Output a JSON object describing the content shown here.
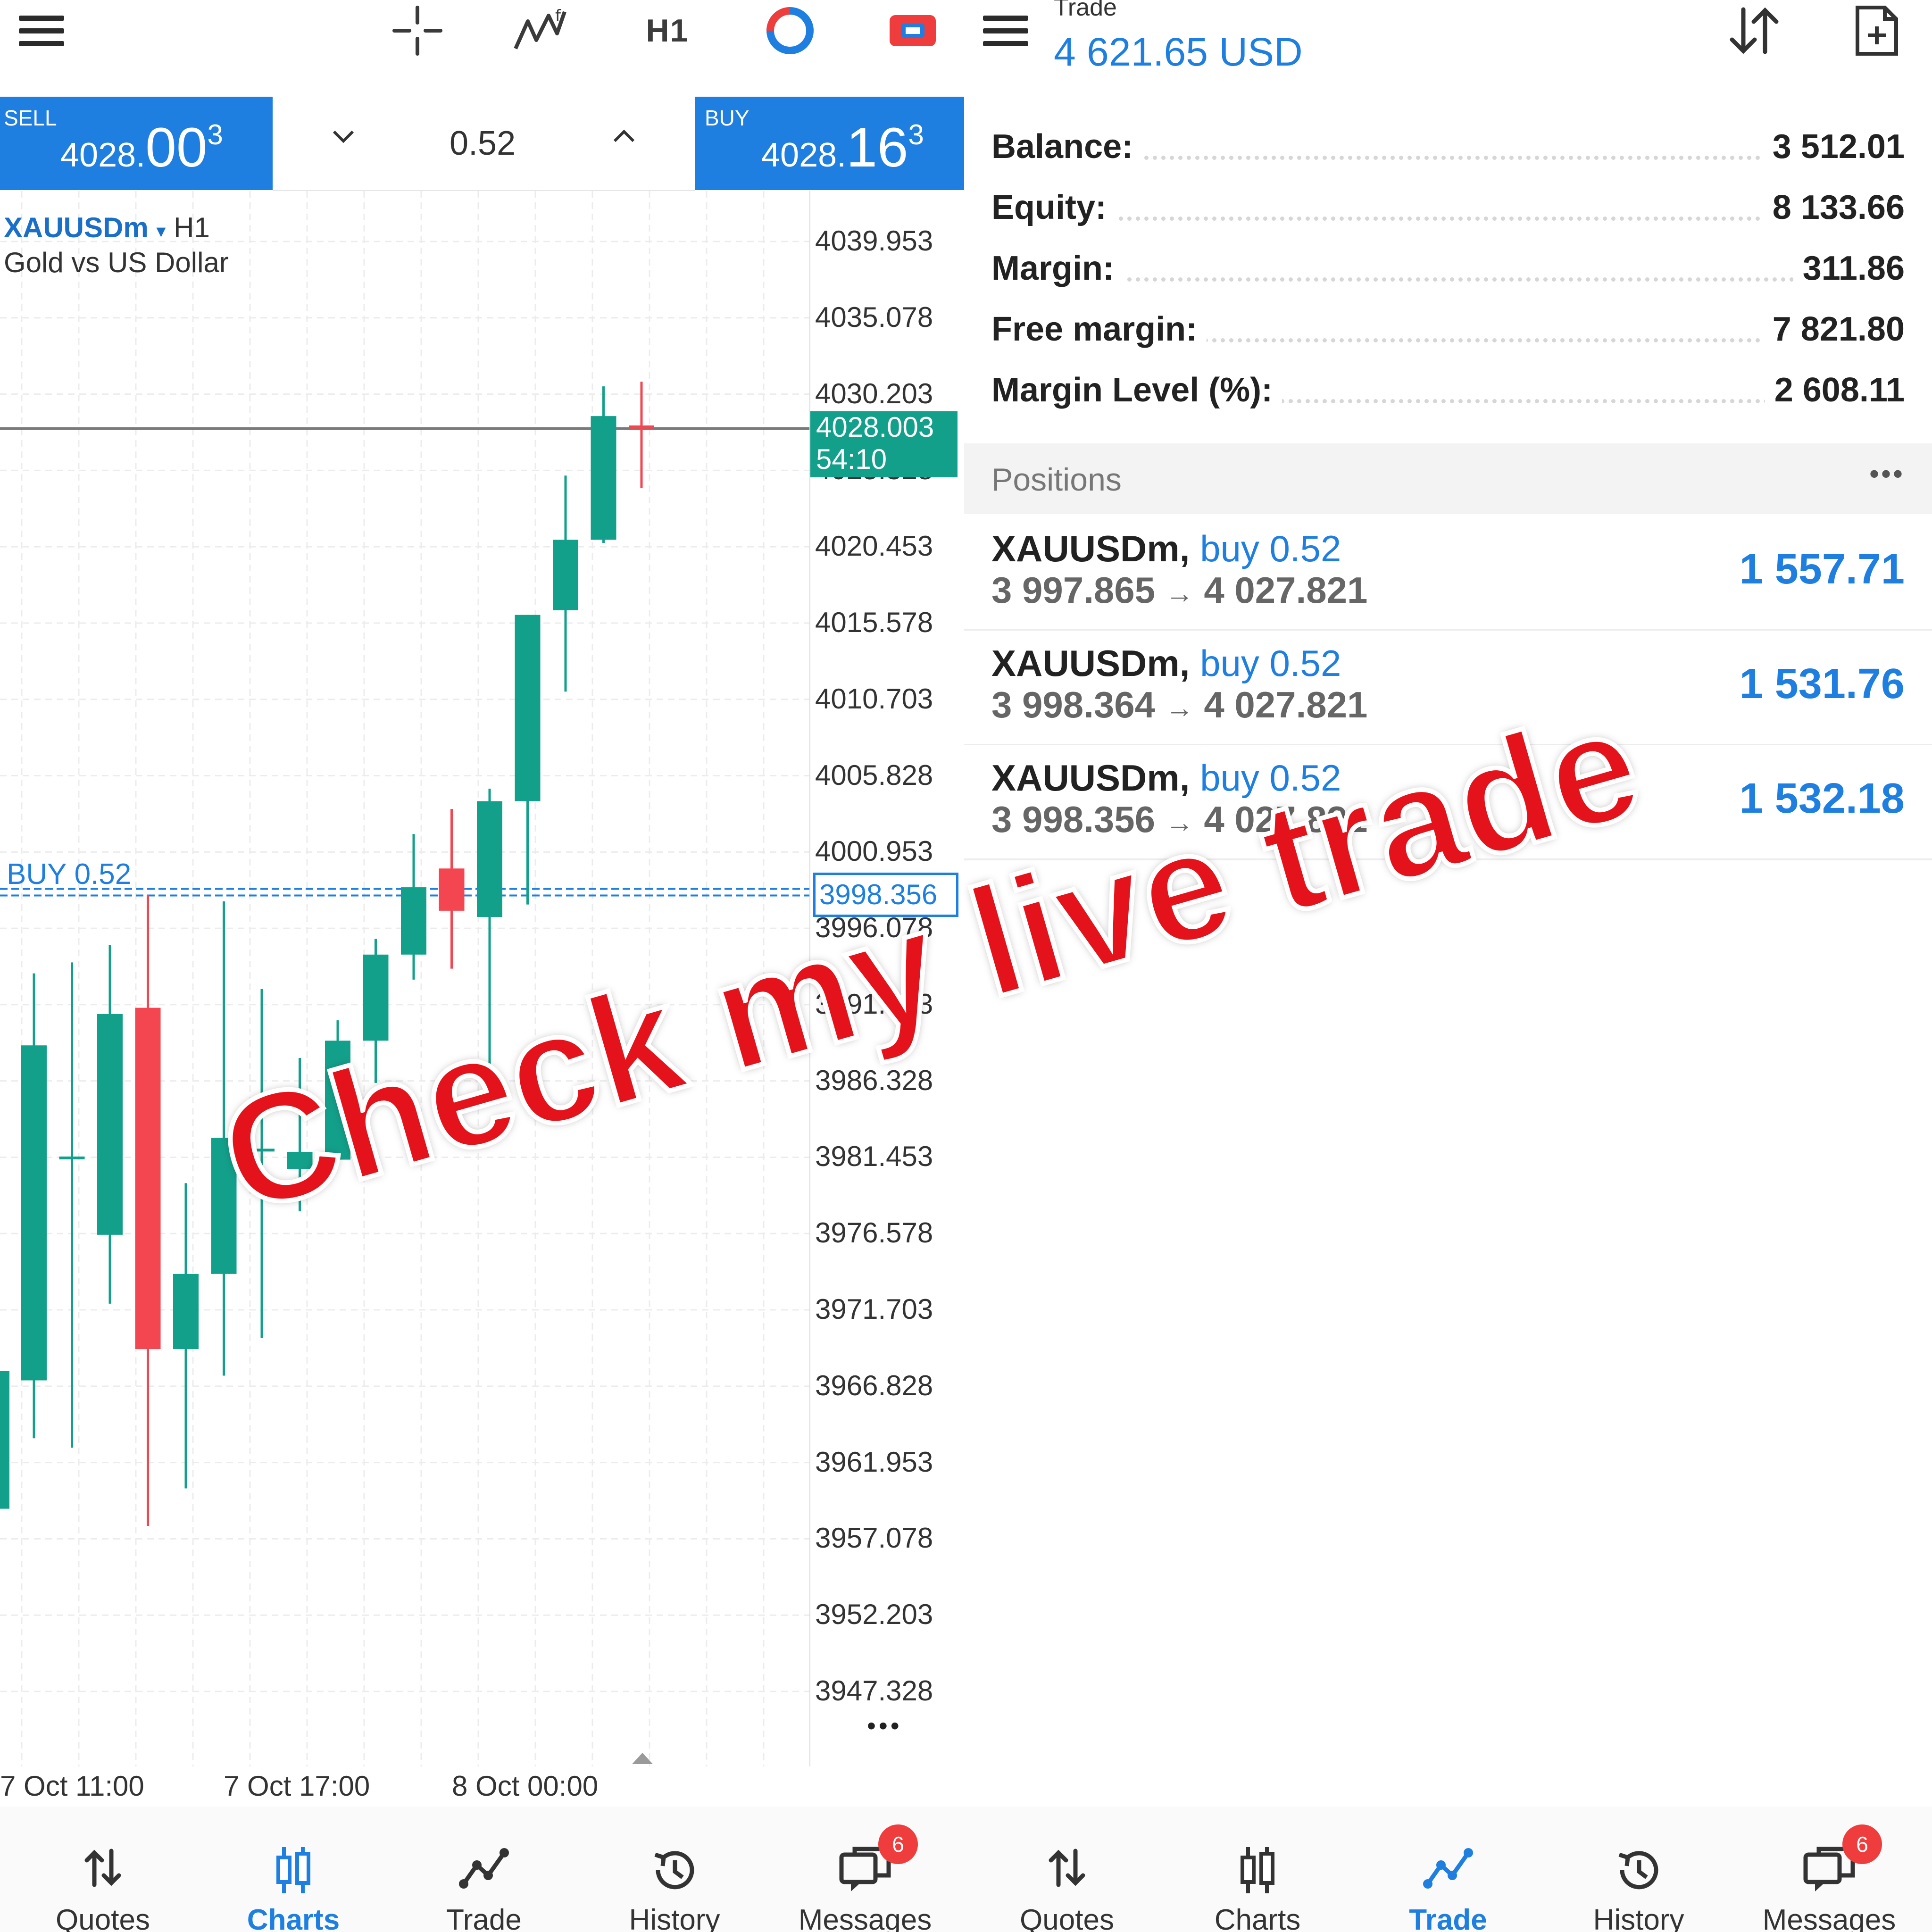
{
  "left_pane": {
    "timeframe": "H1",
    "sell": {
      "label": "SELL",
      "price_main": "4028.",
      "price_big": "00",
      "price_sup": "3"
    },
    "buy": {
      "label": "BUY",
      "price_main": "4028.",
      "price_big": "16",
      "price_sup": "3"
    },
    "volume": "0.52",
    "symbol": "XAUUSDm",
    "symbol_caret": "▾",
    "symbol_tf": "H1",
    "symbol_desc": "Gold vs US Dollar",
    "price_axis": [
      "4039.953",
      "4035.078",
      "4030.203",
      "4025.328",
      "4020.453",
      "4015.578",
      "4010.703",
      "4005.828",
      "4000.953",
      "3996.078",
      "3991.203",
      "3986.328",
      "3981.453",
      "3976.578",
      "3971.703",
      "3966.828",
      "3961.953",
      "3957.078",
      "3952.203",
      "3947.328"
    ],
    "current_price_tag": "4028.003",
    "countdown": "54:10",
    "position_tag": "3998.356",
    "position_line_label": "BUY 0.52",
    "more": "•••",
    "time_axis": [
      "7 Oct 11:00",
      "7 Oct 17:00",
      "8 Oct 00:00"
    ],
    "colors": {
      "bull": "#13a08a",
      "bear": "#f44650",
      "accent": "#1e7fe0"
    }
  },
  "chart_data": {
    "type": "candlestick",
    "ylim": [
      3943.0,
      4044.0
    ],
    "x": [
      "7 Oct 11:00",
      "7 Oct 12:00",
      "7 Oct 13:00",
      "7 Oct 14:00",
      "7 Oct 15:00",
      "7 Oct 16:00",
      "7 Oct 17:00",
      "7 Oct 18:00",
      "7 Oct 19:00",
      "7 Oct 20:00",
      "7 Oct 21:00",
      "7 Oct 22:00",
      "7 Oct 23:00",
      "8 Oct 00:00",
      "8 Oct 01:00",
      "8 Oct 02:00",
      "8 Oct 03:00"
    ],
    "ohlc": [
      [
        3967.2,
        3988.6,
        3963.5,
        3993.2
      ],
      [
        3981.5,
        3981.5,
        3962.9,
        3993.9
      ],
      [
        3976.5,
        3990.6,
        3972.1,
        3995.0
      ],
      [
        3991.0,
        3969.2,
        3957.9,
        3998.2
      ],
      [
        3969.2,
        3974.0,
        3960.3,
        3979.8
      ],
      [
        3974.0,
        3982.7,
        3967.5,
        3997.8
      ],
      [
        3982.0,
        3982.0,
        3969.9,
        3992.2
      ],
      [
        3980.7,
        3981.8,
        3978.0,
        3987.8
      ],
      [
        3981.3,
        3988.9,
        3981.0,
        3990.2
      ],
      [
        3988.9,
        3994.4,
        3986.2,
        3995.4
      ],
      [
        3994.4,
        3998.7,
        3992.8,
        4002.1
      ],
      [
        3999.9,
        3997.2,
        3993.5,
        4003.7
      ],
      [
        3996.8,
        4004.2,
        3987.1,
        4005.0
      ],
      [
        4004.2,
        4016.1,
        3997.6,
        4016.1
      ],
      [
        4016.4,
        4020.9,
        4011.2,
        4025.0
      ],
      [
        4020.9,
        4028.8,
        4020.7,
        4030.7
      ],
      [
        4028.2,
        4028.0,
        4024.2,
        4031.0
      ]
    ],
    "lines": {
      "current": 4028.003,
      "position": 3998.356
    }
  },
  "left_nav": {
    "items": [
      {
        "label": "Quotes"
      },
      {
        "label": "Charts"
      },
      {
        "label": "Trade"
      },
      {
        "label": "History"
      },
      {
        "label": "Messages"
      }
    ],
    "messages_badge": "6",
    "active": "Charts"
  },
  "right_pane": {
    "title": "Trade",
    "total": "4 621.65 USD",
    "account": [
      {
        "key": "Balance:",
        "value": "3 512.01"
      },
      {
        "key": "Equity:",
        "value": "8 133.66"
      },
      {
        "key": "Margin:",
        "value": "311.86"
      },
      {
        "key": "Free margin:",
        "value": "7 821.80"
      },
      {
        "key": "Margin Level (%):",
        "value": "2 608.11"
      }
    ],
    "positions_header": "Positions",
    "positions_more": "•••",
    "positions": [
      {
        "symbol": "XAUUSDm,",
        "dir": "buy 0.52",
        "open": "3 997.865",
        "arrow": "→",
        "current": "4 027.821",
        "profit": "1 557.71"
      },
      {
        "symbol": "XAUUSDm,",
        "dir": "buy 0.52",
        "open": "3 998.364",
        "arrow": "→",
        "current": "4 027.821",
        "profit": "1 531.76"
      },
      {
        "symbol": "XAUUSDm,",
        "dir": "buy 0.52",
        "open": "3 998.356",
        "arrow": "→",
        "current": "4 027.821",
        "profit": "1 532.18"
      }
    ]
  },
  "right_nav": {
    "items": [
      {
        "label": "Quotes"
      },
      {
        "label": "Charts"
      },
      {
        "label": "Trade"
      },
      {
        "label": "History"
      },
      {
        "label": "Messages"
      }
    ],
    "messages_badge": "6",
    "active": "Trade"
  },
  "overlay_text": "Check my live trade"
}
